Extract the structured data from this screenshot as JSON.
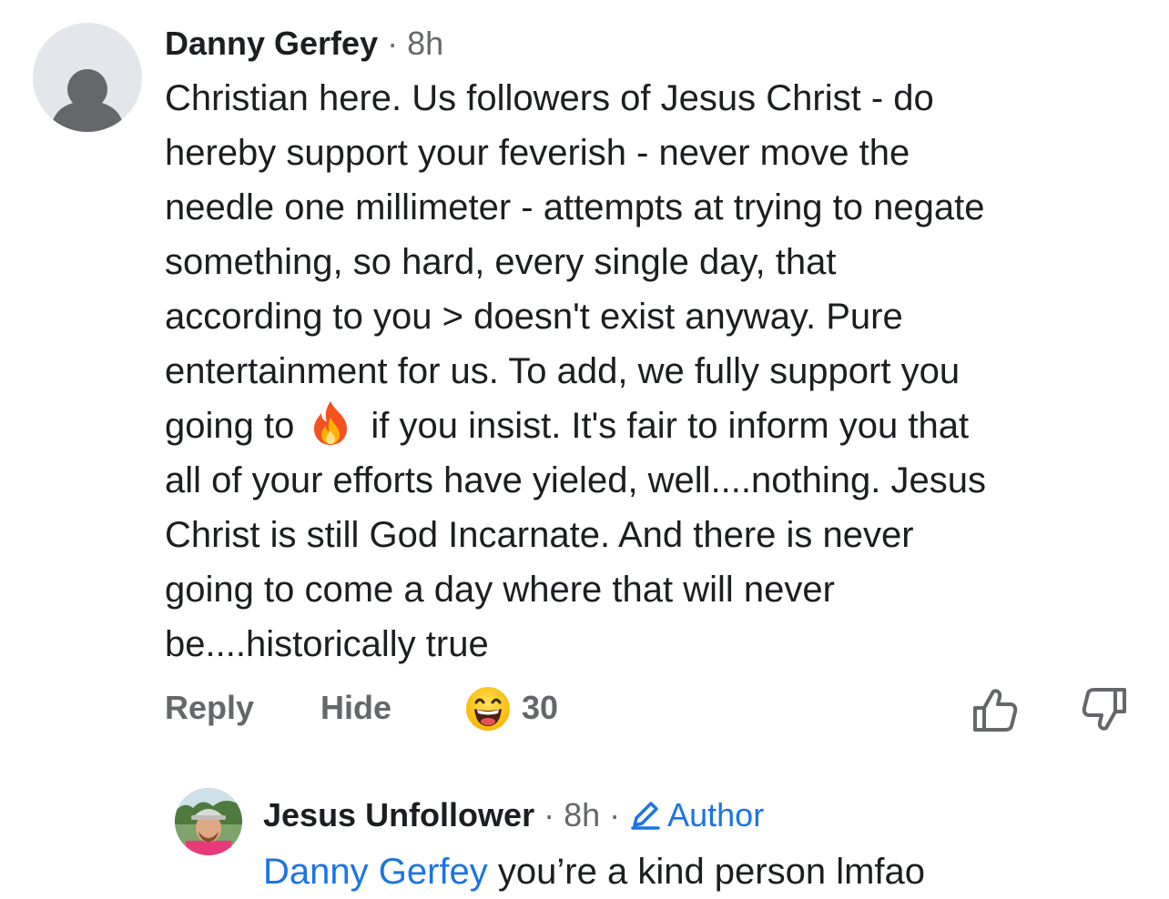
{
  "comment": {
    "author": "Danny Gerfey",
    "separator": " · ",
    "time": "8h",
    "body_lines": [
      "Christian here. Us followers of Jesus Christ - do",
      "hereby support your feverish - never move the",
      "needle one millimeter - attempts at trying to negate",
      "something, so hard, every single day, that",
      "according to you > doesn't exist anyway. Pure",
      "entertainment for us. To add, we fully support you"
    ],
    "body_emoji_line": {
      "before": "going to",
      "emoji": "fire-emoji",
      "after": "if you insist. It's fair to inform you that"
    },
    "body_lines_after": [
      "all of your efforts have yieled, well....nothing. Jesus",
      "Christ is still God Incarnate. And there is never",
      "going to come a day where that will never",
      "be....historically true"
    ],
    "actions": {
      "reply_label": "Reply",
      "hide_label": "Hide",
      "reaction_icon": "grinning-face-emoji",
      "reaction_count": "30",
      "upvote_icon": "thumbs-up-icon",
      "downvote_icon": "thumbs-down-icon"
    }
  },
  "reply": {
    "author": "Jesus Unfollower",
    "separator": " · ",
    "time": "8h",
    "separator2": " · ",
    "badge_icon": "pencil-icon",
    "badge_label": "Author",
    "mention": "Danny Gerfey",
    "text": " you’re a kind person lmfao"
  },
  "colors": {
    "text": "#1c1e21",
    "secondary": "#65676b",
    "link": "#1b74e4"
  }
}
